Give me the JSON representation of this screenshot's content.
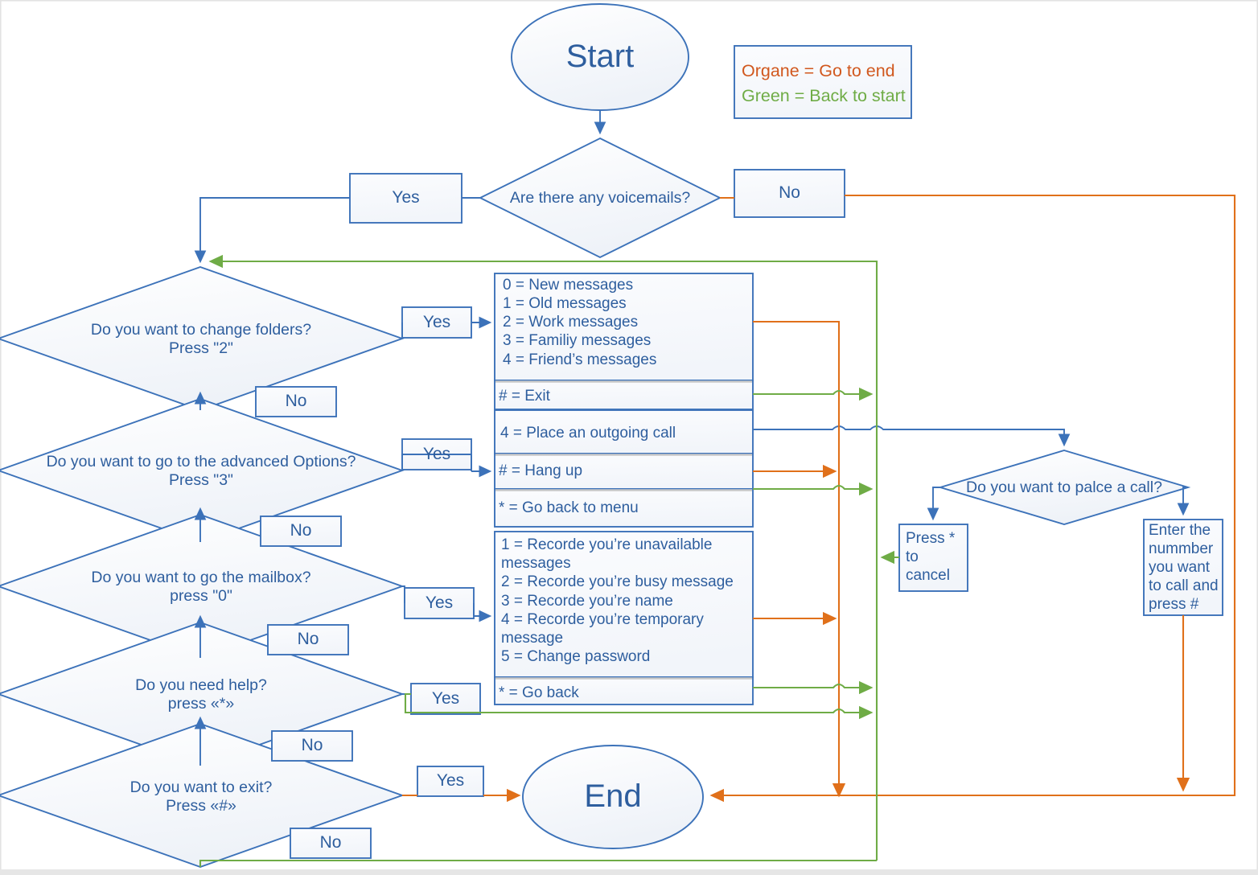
{
  "diagram": {
    "title": "Voicemail IVR flowchart",
    "legend": {
      "line1": "Organe = Go to end",
      "line2": "Green = Back to start",
      "orange_color": "#E0701A",
      "green_color": "#6FAC46",
      "blue_color": "#2E5E9E"
    },
    "terminals": {
      "start": "Start",
      "end": "End"
    },
    "decisions": [
      {
        "id": "voicemails",
        "text": "Are there any voicemails?",
        "line2": ""
      },
      {
        "id": "change-folders",
        "text": "Do you want to change folders?",
        "line2": "Press \"2\""
      },
      {
        "id": "advanced-options",
        "text": "Do you want to go to the advanced Options?",
        "line2": "Press \"3\""
      },
      {
        "id": "mailbox",
        "text": "Do you want to go the mailbox?",
        "line2": "press \"0\""
      },
      {
        "id": "help",
        "text": "Do you need help?",
        "line2": "press «*»"
      },
      {
        "id": "exit",
        "text": "Do you want to exit?",
        "line2": "Press «#»"
      },
      {
        "id": "place-call",
        "text": "Do you want to palce a call?",
        "line2": ""
      }
    ],
    "branch_labels": {
      "voicemails_yes": "Yes",
      "voicemails_no": "No",
      "change_folders_yes": "Yes",
      "change_folders_no": "No",
      "advanced_options_yes": "Yes",
      "advanced_options_no": "No",
      "mailbox_yes": "Yes",
      "mailbox_no": "No",
      "help_yes": "Yes",
      "help_no": "No",
      "exit_yes": "Yes",
      "exit_no": "No"
    },
    "menus": [
      {
        "id": "folders-menu",
        "items": [
          "0 = New messages",
          "1 = Old messages",
          "2 = Work messages",
          "3 = Familiy messages",
          "4 = Friend’s messages"
        ],
        "footer": [
          "# = Exit"
        ]
      },
      {
        "id": "advanced-menu",
        "items": [
          "4 = Place an outgoing call"
        ],
        "footer": [
          "# = Hang up",
          "* = Go back to menu"
        ]
      },
      {
        "id": "mailbox-menu",
        "items": [
          "1 = Recorde you’re unavailable",
          "messages",
          "2 = Recorde you’re busy message",
          "3 = Recorde you’re name",
          "4 = Recorde you’re temporary",
          "message",
          "5 = Change password"
        ],
        "footer": [
          "* = Go back"
        ]
      }
    ],
    "process_boxes": [
      {
        "id": "press-star-cancel",
        "lines": [
          "Press *",
          "to",
          "cancel"
        ]
      },
      {
        "id": "enter-number",
        "lines": [
          "Enter the",
          "nummber",
          "you want",
          "to call and",
          "press #"
        ]
      }
    ]
  }
}
